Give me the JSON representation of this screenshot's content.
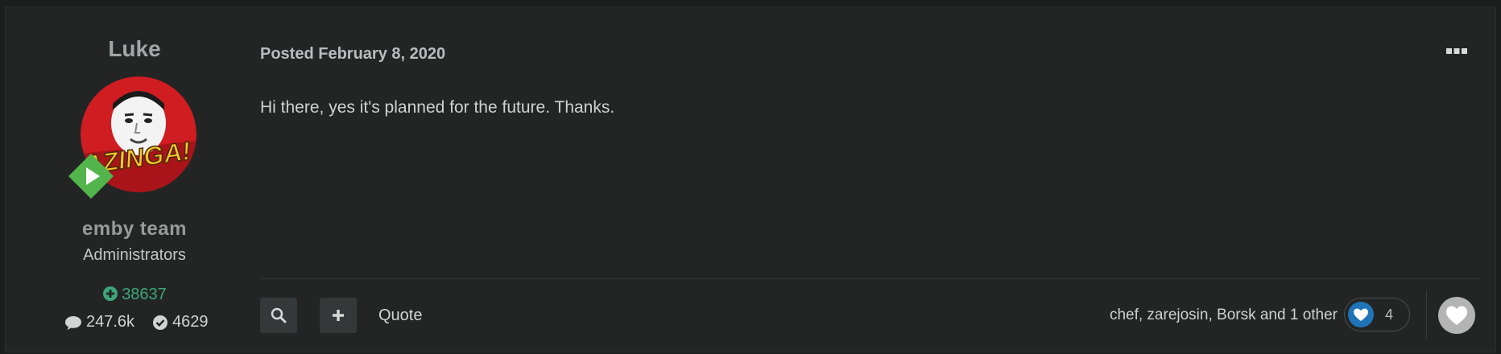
{
  "author": {
    "name": "Luke",
    "team_logo_text": "emby team",
    "group": "Administrators",
    "reputation": "38637",
    "posts_count": "247.6k",
    "solutions_count": "4629",
    "avatar_icon": "sheldon-bazinga-avatar",
    "badge_icon": "emby-play-badge-icon"
  },
  "post": {
    "posted_label": "Posted February 8, 2020",
    "body": "Hi there, yes it's planned for the future. Thanks."
  },
  "toolbar": {
    "search_icon": "search-icon",
    "add_icon": "plus-icon",
    "quote_label": "Quote",
    "likers_text": "chef, zarejosin, Borsk and 1 other",
    "reaction_count": "4"
  },
  "colors": {
    "background": "#232525",
    "reputation": "#3da67a",
    "like_blue": "#1f73b7",
    "emby_green": "#52b54b"
  }
}
